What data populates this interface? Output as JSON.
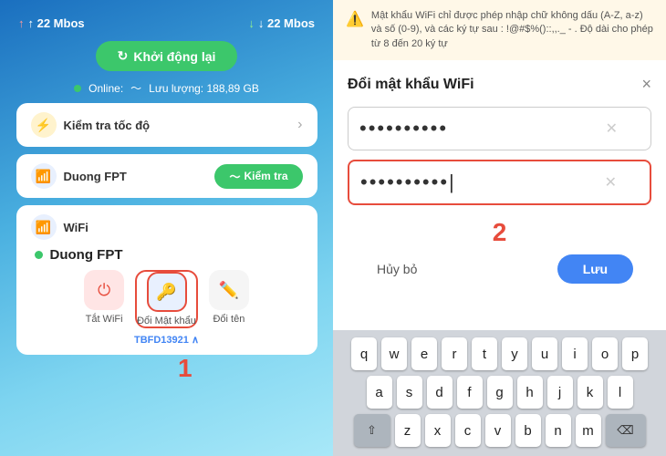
{
  "left": {
    "speed_up": "↑ 22 Mbos",
    "speed_down": "↓ 22 Mbos",
    "restart_label": "Khởi động lại",
    "online_label": "Online:",
    "storage_label": "Lưu lượng: 188,89 GB",
    "check_speed_label": "Kiểm tra tốc độ",
    "network_name": "Duong FPT",
    "check_btn_label": "Kiểm tra",
    "wifi_label": "WiFi",
    "network_name_main": "Duong FPT",
    "btn_off_wifi": "Tắt WiFi",
    "btn_change_pass": "Đổi Mật khẩu",
    "btn_change_name": "Đổi tên",
    "device_id": "TBFD13921",
    "step_number": "1"
  },
  "right": {
    "warning_text": "Mật khẩu WiFi chỉ được phép nhập chữ không dấu (A-Z, a-z) và số (0-9), và các ký tự sau : !@#$%()::,,._ - . Độ dài cho phép từ 8 đến 20 ký tự",
    "dialog_title": "Đổi mật khẩu WiFi",
    "close_label": "×",
    "placeholder_old": "••••••••••",
    "placeholder_new": "••••••••••|",
    "cancel_label": "Hủy bỏ",
    "save_label": "Lưu",
    "step_number": "2",
    "keyboard_row1": [
      "q",
      "w",
      "e",
      "r",
      "t",
      "y",
      "u",
      "i",
      "o",
      "p"
    ],
    "keyboard_row2": [
      "a",
      "s",
      "d",
      "f",
      "g",
      "h",
      "j",
      "k",
      "l"
    ],
    "keyboard_row3": [
      "z",
      "x",
      "c",
      "v",
      "b",
      "n",
      "m"
    ]
  }
}
